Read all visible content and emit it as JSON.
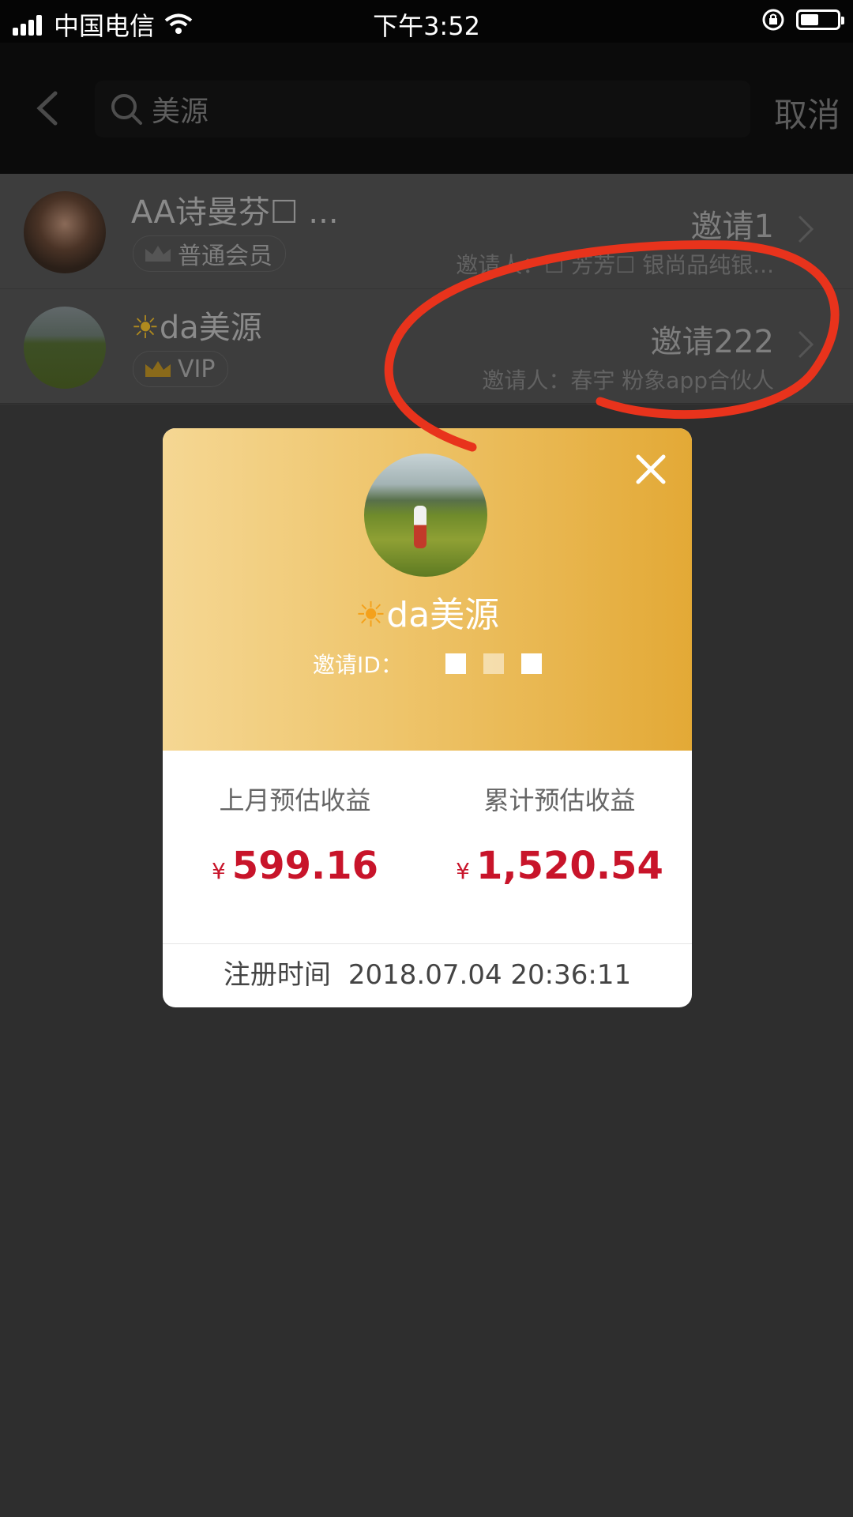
{
  "status_bar": {
    "carrier": "中国电信",
    "time": "下午3:52"
  },
  "nav": {
    "search_query": "美源",
    "cancel_label": "取消"
  },
  "results": [
    {
      "name": "AA诗曼芬☐ ...",
      "badge": "普通会员",
      "invite": "邀请1",
      "inviter": "邀请人：☐ 芳芳☐ 银尚品纯银..."
    },
    {
      "name_icon": "☀",
      "name": "da美源",
      "badge": "VIP",
      "invite": "邀请222",
      "inviter": "邀请人：春宇 粉象app合伙人"
    }
  ],
  "modal": {
    "name_icon": "☀",
    "name": "da美源",
    "invite_id_label": "邀请ID：",
    "last_month_label": "上月预估收益",
    "last_month_currency": "¥",
    "last_month_value": "599.16",
    "total_label": "累计预估收益",
    "total_currency": "¥",
    "total_value": "1,520.54",
    "register_label": "注册时间",
    "register_time": "2018.07.04 20:36:11"
  },
  "colors": {
    "accent_red": "#c8142a",
    "gold_start": "#f5d793",
    "gold_end": "#e3a936",
    "annotation": "#e8331c"
  }
}
